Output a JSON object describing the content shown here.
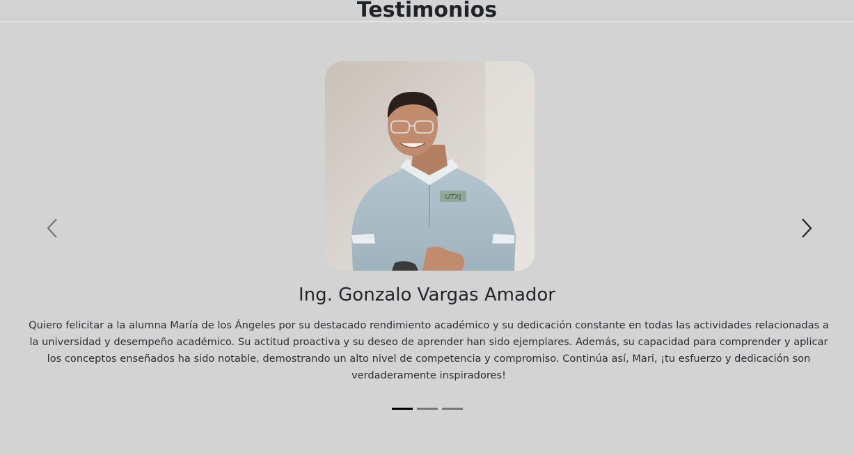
{
  "section": {
    "title": "Testimonios"
  },
  "carousel": {
    "active_index": 0,
    "slide_count": 3,
    "slides": [
      {
        "name": "Ing. Gonzalo Vargas Amador",
        "text": "Quiero felicitar a la alumna María de los Ángeles por su destacado rendimiento académico y su dedicación constante en todas las actividades relacionadas a la universidad y desempeño académico. Su actitud proactiva y su deseo de aprender han sido ejemplares. Además, su capacidad para comprender y aplicar los conceptos enseñados ha sido notable, demostrando un alto nivel de competencia y compromiso. Continúa así, Mari, ¡tu esfuerzo y dedicación son verdaderamente inspiradores!",
        "photo_shirt_logo": "UTXJ"
      }
    ],
    "prev_icon": "chevron-left-icon",
    "next_icon": "chevron-right-icon"
  },
  "colors": {
    "background": "#d3d3d3",
    "indicator_active": "#000000",
    "indicator_inactive": "#777777"
  }
}
